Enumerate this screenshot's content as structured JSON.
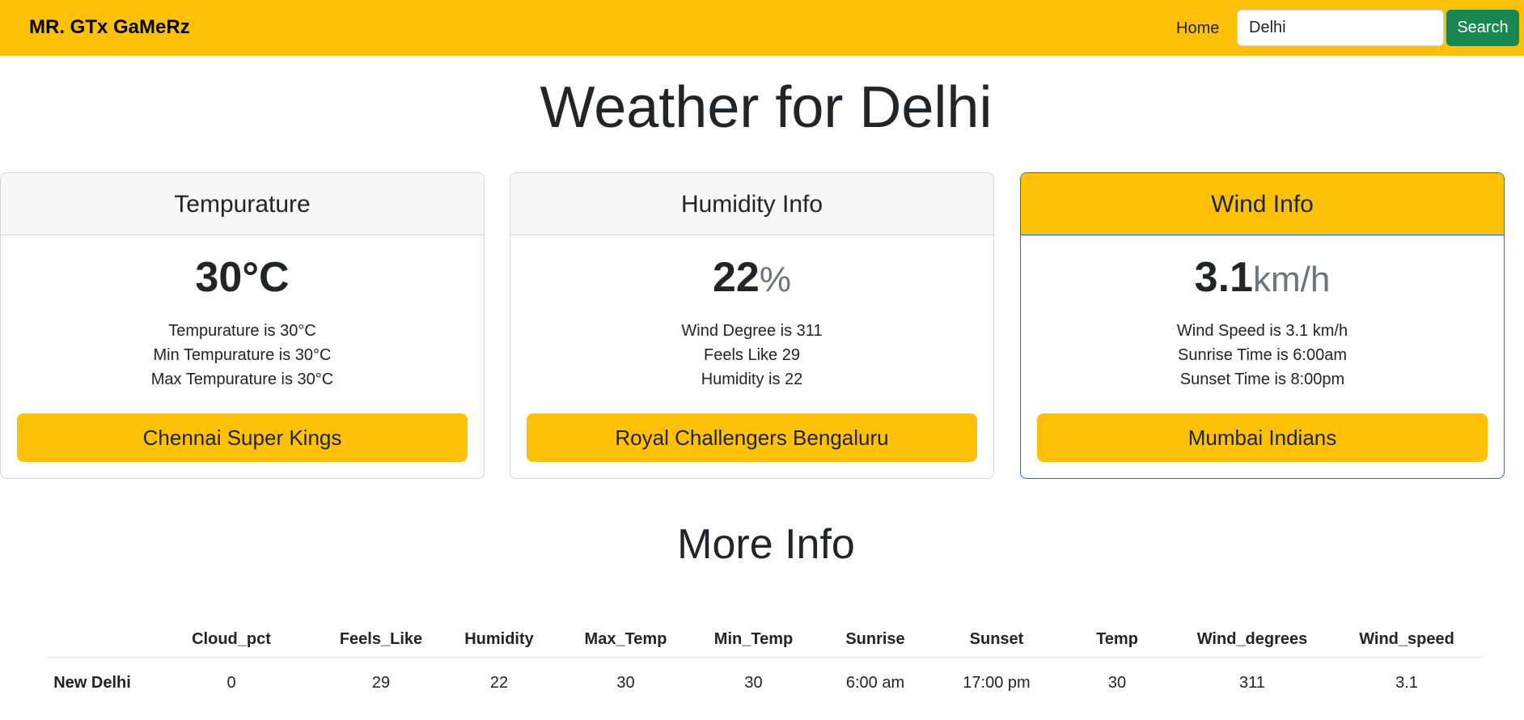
{
  "navbar": {
    "brand": "MR. GTx GaMeRz",
    "home": "Home",
    "search_value": "Delhi",
    "search_button": "Search"
  },
  "page_title": "Weather for Delhi",
  "cards": [
    {
      "title": "Tempurature",
      "value": "30°C",
      "unit": "",
      "lines": [
        "Tempurature is 30°C",
        "Min Tempurature is 30°C",
        "Max Tempurature is 30°C"
      ],
      "button": "Chennai Super Kings"
    },
    {
      "title": "Humidity Info",
      "value": "22",
      "unit": "%",
      "lines": [
        "Wind Degree is 311",
        "Feels Like 29",
        "Humidity is 22"
      ],
      "button": "Royal Challengers Bengaluru"
    },
    {
      "title": "Wind Info",
      "value": "3.1",
      "unit": "km/h",
      "lines": [
        "Wind Speed is 3.1 km/h",
        "Sunrise Time is 6:00am",
        "Sunset Time is 8:00pm"
      ],
      "button": "Mumbai Indians"
    }
  ],
  "more_info": {
    "title": "More Info",
    "columns": [
      "",
      "Cloud_pct",
      "Feels_Like",
      "Humidity",
      "Max_Temp",
      "Min_Temp",
      "Sunrise",
      "Sunset",
      "Temp",
      "Wind_degrees",
      "Wind_speed"
    ],
    "rows": [
      [
        "New Delhi",
        "0",
        "29",
        "22",
        "30",
        "30",
        "6:00 am",
        "17:00 pm",
        "30",
        "311",
        "3.1"
      ]
    ]
  },
  "colors": {
    "accent": "#ffc107",
    "search_button": "#198754",
    "active_border": "#0d6efd"
  }
}
